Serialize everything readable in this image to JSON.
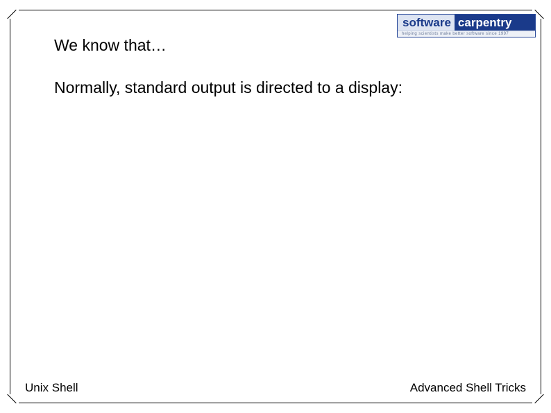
{
  "logo": {
    "left": "software",
    "right": "carpentry",
    "tagline": "helping scientists make better software since 1997"
  },
  "content": {
    "line1": "We know that…",
    "line2": "Normally, standard output is directed to a display:"
  },
  "footer": {
    "left": "Unix Shell",
    "right": "Advanced Shell Tricks"
  }
}
